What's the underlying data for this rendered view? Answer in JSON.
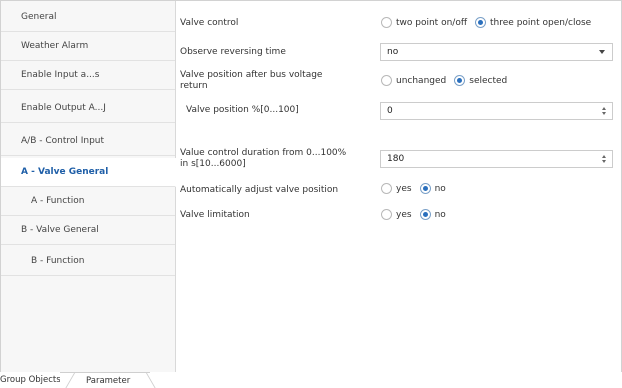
{
  "sidebar": {
    "items": [
      {
        "label": "General",
        "active": false
      },
      {
        "label": "Weather Alarm",
        "active": false
      },
      {
        "label": "Enable Input a...s",
        "active": false
      },
      {
        "label": "Enable Output A...J",
        "active": false
      },
      {
        "label": "A/B - Control Input",
        "active": false
      },
      {
        "label": "A - Valve General",
        "active": true
      },
      {
        "label": "A - Function",
        "active": false
      },
      {
        "label": "B - Valve General",
        "active": false
      },
      {
        "label": "B - Function",
        "active": false
      }
    ]
  },
  "params": {
    "valve_control": {
      "label": "Valve control",
      "options": [
        "two point on/off",
        "three point open/close"
      ],
      "selected": "three point open/close"
    },
    "observe_reversing": {
      "label": "Observe reversing time",
      "value": "no"
    },
    "valve_position_return": {
      "label_line1": "Valve position after bus voltage",
      "label_line2": "return",
      "options": [
        "unchanged",
        "selected"
      ],
      "selected": "selected"
    },
    "valve_position_pct": {
      "label": "Valve position %[0...100]",
      "value": "0"
    },
    "control_duration": {
      "label_line1": "Value control duration from 0...100%",
      "label_line2": "in s[10...6000]",
      "value": "180"
    },
    "auto_adjust": {
      "label": "Automatically adjust valve position",
      "options": [
        "yes",
        "no"
      ],
      "selected": "no"
    },
    "valve_limitation": {
      "label": "Valve limitation",
      "options": [
        "yes",
        "no"
      ],
      "selected": "no"
    }
  },
  "tabs": {
    "group_objects": "Group Objects",
    "parameter": "Parameter"
  },
  "colors": {
    "accent": "#1f5fa8",
    "radio_dot": "#2a6fbd",
    "sidebar_bg": "#f7f7f7"
  }
}
